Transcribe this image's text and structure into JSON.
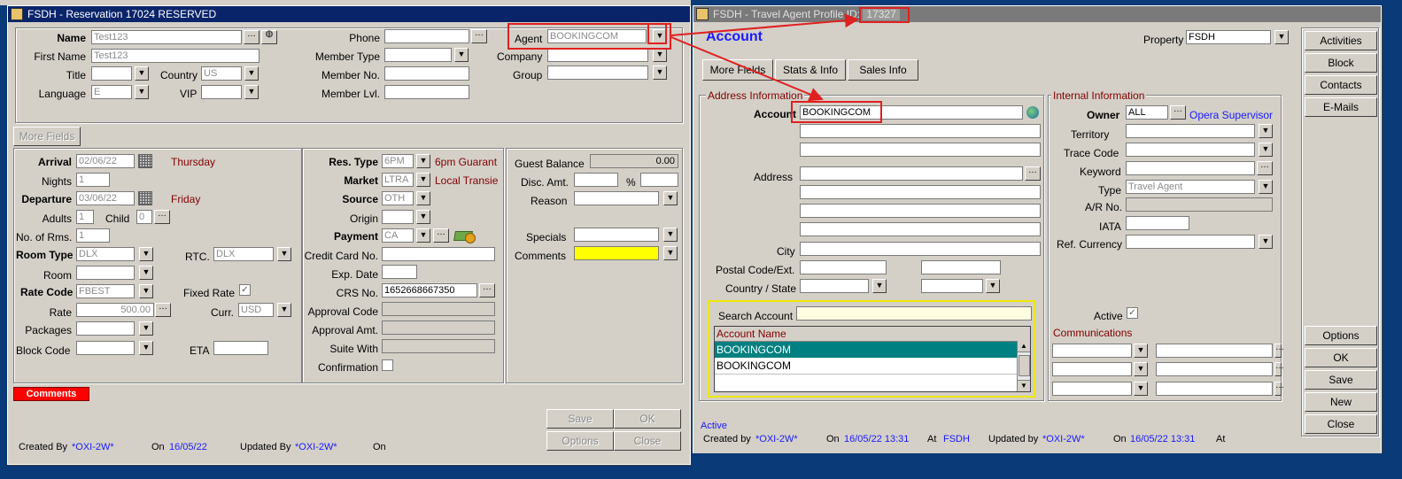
{
  "reservation": {
    "title": "FSDH - Reservation 17024  RESERVED",
    "name_label": "Name",
    "name_value": "Test123",
    "first_name_label": "First Name",
    "first_name_value": "Test123",
    "title_label": "Title",
    "country_label": "Country",
    "country_value": "US",
    "language_label": "Language",
    "language_value": "E",
    "vip_label": "VIP",
    "phone_label": "Phone",
    "member_type_label": "Member Type",
    "member_no_label": "Member No.",
    "member_lvl_label": "Member Lvl.",
    "agent_label": "Agent",
    "agent_value": "BOOKINGCOM",
    "company_label": "Company",
    "group_label": "Group",
    "more_fields_label": "More Fields",
    "arrival_label": "Arrival",
    "arrival_value": "02/06/22",
    "arrival_day": "Thursday",
    "nights_label": "Nights",
    "nights_value": "1",
    "departure_label": "Departure",
    "departure_value": "03/06/22",
    "departure_day": "Friday",
    "adults_label": "Adults",
    "adults_value": "1",
    "child_label": "Child",
    "child_value": "0",
    "rooms_label": "No. of Rms.",
    "rooms_value": "1",
    "room_type_label": "Room Type",
    "room_type_value": "DLX",
    "rtc_label": "RTC.",
    "rtc_value": "DLX",
    "room_label": "Room",
    "rate_code_label": "Rate Code",
    "rate_code_value": "FBEST",
    "fixed_rate_label": "Fixed Rate",
    "rate_label": "Rate",
    "rate_value": "500.00",
    "curr_label": "Curr.",
    "curr_value": "USD",
    "packages_label": "Packages",
    "block_code_label": "Block Code",
    "eta_label": "ETA",
    "res_type_label": "Res. Type",
    "res_type_value": "6PM",
    "res_type_desc": "6pm Guarant",
    "market_label": "Market",
    "market_value": "LTRA",
    "market_desc": "Local Transie",
    "source_label": "Source",
    "source_value": "OTH",
    "origin_label": "Origin",
    "payment_label": "Payment",
    "payment_value": "CA",
    "credit_card_label": "Credit Card No.",
    "exp_date_label": "Exp. Date",
    "crs_label": "CRS No.",
    "crs_value": "1652668667350",
    "approval_code_label": "Approval Code",
    "approval_amt_label": "Approval Amt.",
    "suite_with_label": "Suite With",
    "confirmation_label": "Confirmation",
    "guest_balance_label": "Guest Balance",
    "guest_balance_value": "0.00",
    "disc_amt_label": "Disc. Amt.",
    "percent_label": "%",
    "reason_label": "Reason",
    "specials_label": "Specials",
    "comments_label": "Comments",
    "comments_tab": "Comments",
    "save_label": "Save",
    "ok_label": "OK",
    "options_label": "Options",
    "close_label": "Close",
    "created_by_label": "Created By",
    "created_by_value": "*OXI-2W*",
    "on_label": "On",
    "created_on_value": "16/05/22",
    "updated_by_label": "Updated By",
    "updated_by_value": "*OXI-2W*",
    "updated_on_label": "On"
  },
  "profile": {
    "title": "FSDH - Travel Agent Profile ID:",
    "title_id": "17327",
    "heading": "Account",
    "property_label": "Property",
    "property_value": "FSDH",
    "tabs": [
      "More Fields",
      "Stats & Info",
      "Sales Info"
    ],
    "address_info_label": "Address Information",
    "account_label": "Account",
    "account_value": "BOOKINGCOM",
    "address_label": "Address",
    "city_label": "City",
    "postal_label": "Postal Code/Ext.",
    "country_state_label": "Country / State",
    "search_account_label": "Search Account",
    "account_name_header": "Account Name",
    "account_rows": [
      "BOOKINGCOM",
      "BOOKINGCOM"
    ],
    "internal_info_label": "Internal Information",
    "owner_label": "Owner",
    "owner_value": "ALL",
    "owner_name": "Opera Supervisor",
    "territory_label": "Territory",
    "trace_code_label": "Trace Code",
    "keyword_label": "Keyword",
    "type_label": "Type",
    "type_value": "Travel Agent",
    "ar_label": "A/R No.",
    "iata_label": "IATA",
    "ref_currency_label": "Ref. Currency",
    "active_label": "Active",
    "communications_label": "Communications",
    "status": "Active",
    "created_by_label": "Created by",
    "created_by_value": "*OXI-2W*",
    "on_label": "On",
    "created_on_value": "16/05/22 13:31",
    "at_label": "At",
    "created_at_value": "FSDH",
    "updated_by_label": "Updated by",
    "updated_by_value": "*OXI-2W*",
    "updated_on_label": "On",
    "updated_on_value": "16/05/22 13:31",
    "updated_at_label": "At",
    "side_buttons_top": [
      "Activities",
      "Block",
      "Contacts",
      "E-Mails"
    ],
    "side_buttons_bottom": [
      "Options",
      "OK",
      "Save",
      "New",
      "Close"
    ]
  },
  "colors": {
    "title_active": "#0a246a",
    "highlight": "#e02020",
    "teal_row": "#008080",
    "yellow": "#ffff00",
    "maroon": "#800000",
    "blue": "#1a1aff"
  }
}
